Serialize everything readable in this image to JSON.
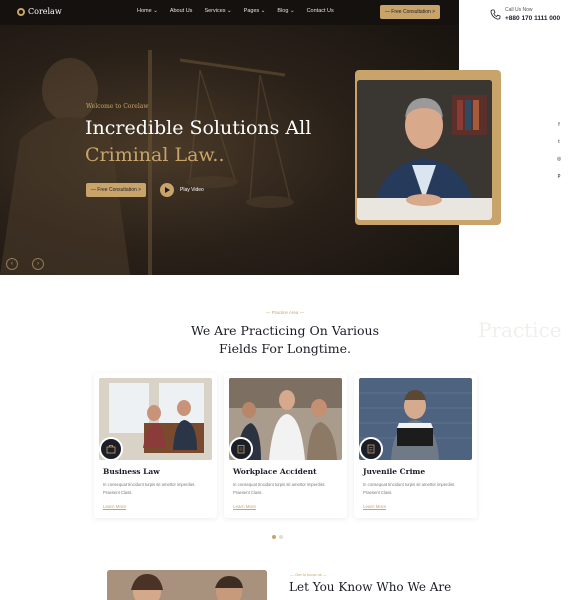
{
  "brand": {
    "name": "Corelaw"
  },
  "nav": {
    "items": [
      "Home",
      "About Us",
      "Services",
      "Pages",
      "Blog",
      "Contact Us"
    ],
    "dropdown_flags": [
      true,
      false,
      true,
      true,
      true,
      false
    ]
  },
  "header": {
    "cta_label": "— Free Consultation >",
    "call_label": "Call Us Now",
    "phone": "+880 170 1111 000"
  },
  "hero": {
    "welcome": "Welcome to Corelaw",
    "title_line1": "Incredible Solutions All",
    "title_line2": "Criminal Law..",
    "cta_label": "— Free Consultation >",
    "play_label": "Play Video"
  },
  "social": {
    "icons": [
      "facebook-icon",
      "twitter-icon",
      "instagram-icon",
      "pinterest-icon"
    ],
    "glyphs": [
      "f",
      "t",
      "◎",
      "p"
    ]
  },
  "practice": {
    "eyebrow": "— Practice Area —",
    "title_line1": "We Are Practicing On Various",
    "title_line2": "Fields For Longtime.",
    "watermark": "Practice",
    "cards": [
      {
        "title": "Business Law",
        "text": "In consequat tincidunt turpis sit amettor imperdiet. Praesent Class.",
        "link": "Learn More"
      },
      {
        "title": "Workplace Accident",
        "text": "In consequat tincidunt turpis sit amettor imperdiet. Praesent Class.",
        "link": "Learn More"
      },
      {
        "title": "Juvenile Crime",
        "text": "In consequat tincidunt turpis sit amettor imperdiet. Praesent Class.",
        "link": "Learn More"
      }
    ]
  },
  "about": {
    "eyebrow": "— Get to know us —",
    "title": "Let You Know Who We Are"
  },
  "colors": {
    "accent": "#c9a46a",
    "dark": "#1b1d27",
    "hero_bg": "#2a2119"
  }
}
